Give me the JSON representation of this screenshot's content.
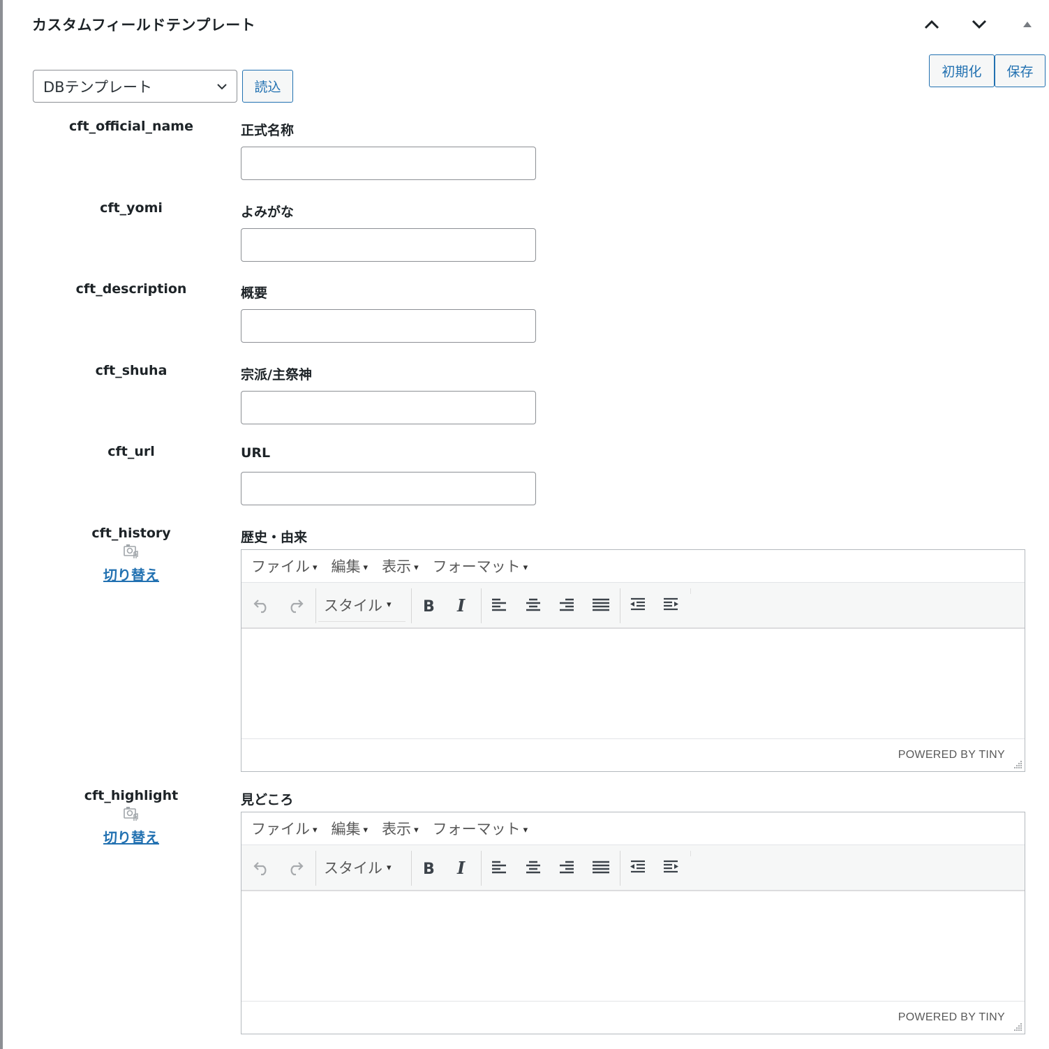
{
  "panel": {
    "title": "カスタムフィールドテンプレート",
    "move_up_icon": "chevron-up-icon",
    "move_down_icon": "chevron-down-icon",
    "collapse_icon": "triangle-up-icon"
  },
  "template_select": {
    "value": "DBテンプレート"
  },
  "buttons": {
    "load": "読込",
    "reset": "初期化",
    "save": "保存"
  },
  "fields": [
    {
      "key": "cft_official_name",
      "label": "正式名称",
      "value": ""
    },
    {
      "key": "cft_yomi",
      "label": "よみがな",
      "value": ""
    },
    {
      "key": "cft_description",
      "label": "概要",
      "value": ""
    },
    {
      "key": "cft_shuha",
      "label": "宗派/主祭神",
      "value": ""
    },
    {
      "key": "cft_url",
      "label": "URL",
      "value": ""
    }
  ],
  "rich_fields": [
    {
      "key": "cft_history",
      "label": "歴史・由来",
      "toggle": "切り替え",
      "media_icon": "add-media-icon"
    },
    {
      "key": "cft_highlight",
      "label": "見どころ",
      "toggle": "切り替え",
      "media_icon": "add-media-icon"
    }
  ],
  "editor": {
    "menu": [
      "ファイル",
      "編集",
      "表示",
      "フォーマット"
    ],
    "menu_caret": "▾",
    "style_dropdown": "スタイル",
    "powered_by": "POWERED BY TINY",
    "toolbar_icons": [
      "undo-icon",
      "redo-icon",
      "bold-icon",
      "italic-icon",
      "align-left-icon",
      "align-center-icon",
      "align-right-icon",
      "align-justify-icon",
      "outdent-icon",
      "indent-icon"
    ]
  },
  "colors": {
    "accent": "#2271b1",
    "text": "#1d2327",
    "border": "#8c8f94",
    "toolbar_bg": "#f6f7f7"
  }
}
